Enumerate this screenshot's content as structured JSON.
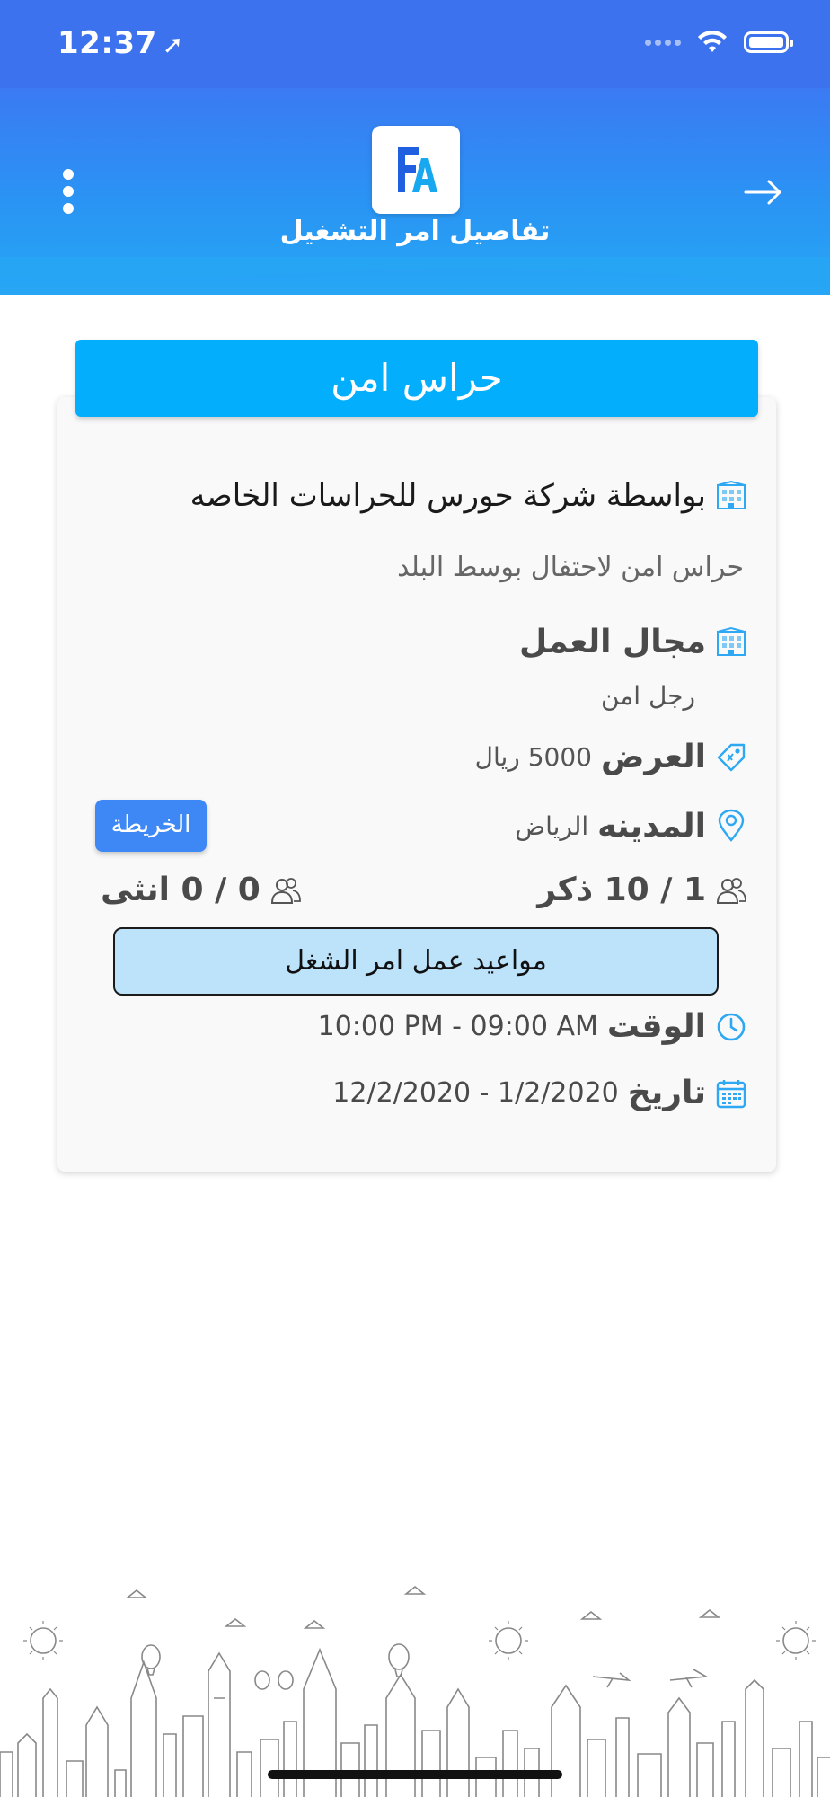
{
  "status_bar": {
    "time": "12:37"
  },
  "header": {
    "title": "تفاصيل امر التشغيل"
  },
  "card": {
    "title": "حراس امن",
    "company": "بواسطة شركة حورس للحراسات الخاصه",
    "description": "حراس امن لاحتفال بوسط البلد",
    "field_label": "مجال العمل",
    "field_value": "رجل امن",
    "offer_label": "العرض",
    "offer_value": "5000 ريال",
    "city_label": "المدينه",
    "city_value": "الرياض",
    "map_button": "الخريطة",
    "male_count": "1 / 10 ذكر",
    "female_count": "0 / 0 انثى",
    "schedule_button": "مواعيد عمل امر الشغل",
    "time_label": "الوقت",
    "time_value": "10:00 PM - 09:00 AM",
    "date_label": "تاريخ",
    "date_value": "12/2/2020 - 1/2/2020"
  },
  "colors": {
    "header_top": "#3b7af3",
    "header_bottom": "#26a7f5",
    "card_title_bg": "#03aefc",
    "map_button_bg": "#3d88f5",
    "schedule_button_bg": "#bde3fb",
    "icon_blue": "#2ea8f2"
  },
  "icons": {
    "menu": "more-vertical-icon",
    "back": "arrow-right-icon",
    "company": "building-icon",
    "field": "building-icon",
    "offer": "price-tag-icon",
    "city": "location-pin-icon",
    "male": "users-icon",
    "female": "users-icon",
    "time": "clock-icon",
    "date": "calendar-icon"
  }
}
